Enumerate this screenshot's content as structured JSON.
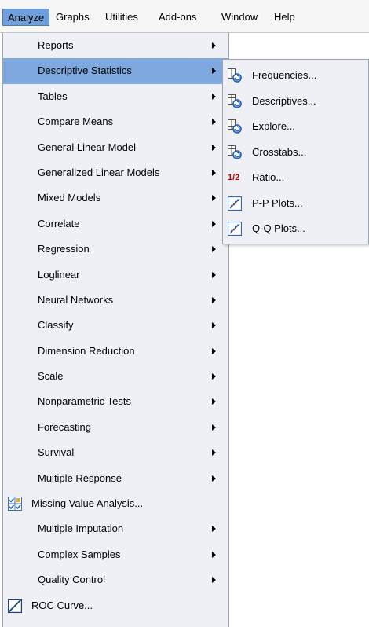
{
  "menubar": {
    "items": [
      {
        "label": "Analyze",
        "underline_char": "A",
        "active": true
      },
      {
        "label": "Graphs",
        "underline_char": "G"
      },
      {
        "label": "Utilities",
        "underline_char": "U"
      },
      {
        "label": "Add-ons",
        "underline_char": "o"
      },
      {
        "label": "Window",
        "underline_char": "W"
      },
      {
        "label": "Help",
        "underline_char": "H"
      }
    ]
  },
  "analyze_menu": {
    "items": [
      {
        "label": "Reports",
        "submenu": true
      },
      {
        "label": "Descriptive Statistics",
        "submenu": true,
        "selected": true
      },
      {
        "label": "Tables",
        "submenu": true
      },
      {
        "label": "Compare Means",
        "submenu": true
      },
      {
        "label": "General Linear Model",
        "submenu": true
      },
      {
        "label": "Generalized Linear Models",
        "submenu": true
      },
      {
        "label": "Mixed Models",
        "submenu": true
      },
      {
        "label": "Correlate",
        "submenu": true
      },
      {
        "label": "Regression",
        "submenu": true
      },
      {
        "label": "Loglinear",
        "submenu": true
      },
      {
        "label": "Neural Networks",
        "submenu": true
      },
      {
        "label": "Classify",
        "submenu": true
      },
      {
        "label": "Dimension Reduction",
        "submenu": true
      },
      {
        "label": "Scale",
        "submenu": true
      },
      {
        "label": "Nonparametric Tests",
        "submenu": true
      },
      {
        "label": "Forecasting",
        "submenu": true
      },
      {
        "label": "Survival",
        "submenu": true
      },
      {
        "label": "Multiple Response",
        "submenu": true
      },
      {
        "label": "Missing Value Analysis...",
        "icon": "missing-value-icon"
      },
      {
        "label": "Multiple Imputation",
        "submenu": true
      },
      {
        "label": "Complex Samples",
        "submenu": true
      },
      {
        "label": "Quality Control",
        "submenu": true
      },
      {
        "label": "ROC Curve...",
        "icon": "roc-curve-icon"
      }
    ]
  },
  "descriptive_submenu": {
    "items": [
      {
        "label": "Frequencies...",
        "icon": "frequencies-icon"
      },
      {
        "label": "Descriptives...",
        "icon": "descriptives-icon"
      },
      {
        "label": "Explore...",
        "icon": "explore-icon"
      },
      {
        "label": "Crosstabs...",
        "icon": "crosstabs-icon"
      },
      {
        "label": "Ratio...",
        "icon": "ratio-icon",
        "icon_text": "1/2"
      },
      {
        "label": "P-P Plots...",
        "icon": "pp-plots-icon"
      },
      {
        "label": "Q-Q Plots...",
        "icon": "qq-plots-icon"
      }
    ]
  },
  "colors": {
    "highlight": "#7ea8de",
    "menubar_active": "#6fa0dd",
    "menu_bg": "#eef0f5"
  }
}
